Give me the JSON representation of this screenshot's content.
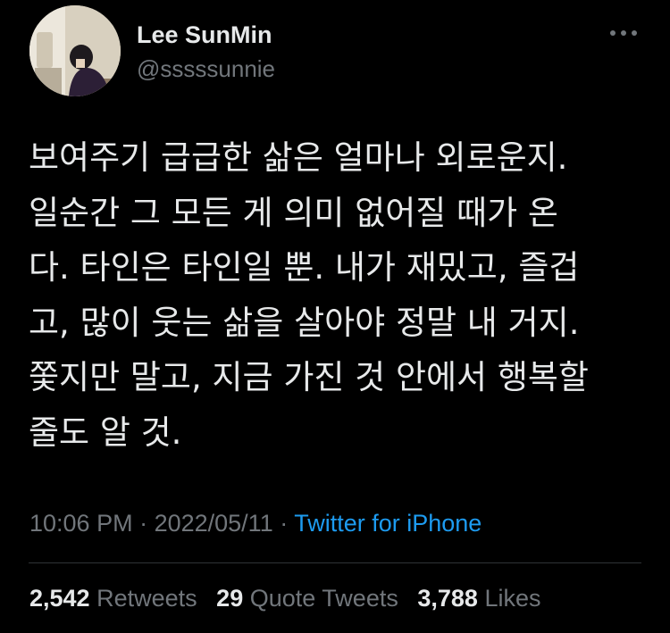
{
  "author": {
    "name": "Lee SunMin",
    "handle": "@sssssunnie"
  },
  "tweet": {
    "text": "보여주기 급급한 삶은 얼마나 외로운지.\n일순간 그 모든 게 의미 없어질 때가 온\n다. 타인은 타인일 뿐. 내가 재밌고, 즐겁\n고, 많이 웃는 삶을 살아야 정말 내 거지.\n쫓지만 말고, 지금 가진 것 안에서 행복할\n줄도 알 것.",
    "time": "10:06 PM",
    "separator1": " · ",
    "date": "2022/05/11",
    "separator2": " · ",
    "source": "Twitter for iPhone"
  },
  "stats": {
    "retweets_count": "2,542",
    "retweets_label": "Retweets",
    "quotes_count": "29",
    "quotes_label": "Quote Tweets",
    "likes_count": "3,788",
    "likes_label": "Likes"
  },
  "icons": {
    "more": "more-horizontal-icon"
  },
  "colors": {
    "background": "#000000",
    "primary_text": "#e7e9ea",
    "secondary_text": "#71767b",
    "link": "#1d9bf0",
    "divider": "#2f3336"
  }
}
